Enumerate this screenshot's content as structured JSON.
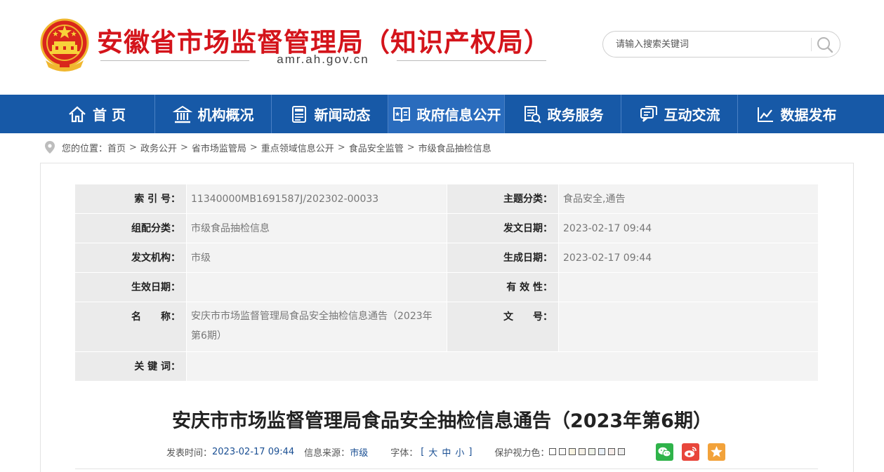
{
  "header": {
    "title": "安徽省市场监督管理局（知识产权局）",
    "domain": "amr.ah.gov.cn",
    "search_placeholder": "请输入搜索关键词"
  },
  "nav": [
    {
      "label": "首 页",
      "icon": "home-icon"
    },
    {
      "label": "机构概况",
      "icon": "building-icon"
    },
    {
      "label": "新闻动态",
      "icon": "news-icon"
    },
    {
      "label": "政府信息公开",
      "icon": "info-book-icon"
    },
    {
      "label": "政务服务",
      "icon": "service-doc-icon"
    },
    {
      "label": "互动交流",
      "icon": "chat-icon"
    },
    {
      "label": "数据发布",
      "icon": "chart-icon"
    }
  ],
  "breadcrumb": {
    "prefix": "您的位置：",
    "items": [
      "首页",
      "政务公开",
      "省市场监管局",
      "重点领域信息公开",
      "食品安全监管",
      "市级食品抽检信息"
    ],
    "separator": ">"
  },
  "meta": {
    "index_label": "索 引 号：",
    "index_value": "11340000MB1691587J/202302-00033",
    "topic_label": "主题分类：",
    "topic_value": "食品安全,通告",
    "group_label": "组配分类：",
    "group_value": "市级食品抽检信息",
    "issue_date_label": "发文日期：",
    "issue_date_value": "2023-02-17 09:44",
    "issuer_label": "发文机构：",
    "issuer_value": "市级",
    "created_label": "生成日期：",
    "created_value": "2023-02-17 09:44",
    "effective_label": "生效日期：",
    "effective_value": "",
    "validity_label": "有 效 性：",
    "validity_value": "",
    "name_label": "名　　称：",
    "name_value": "安庆市市场监督管理局食品安全抽检信息通告（2023年第6期）",
    "docno_label": "文　　号：",
    "docno_value": "",
    "keywords_label": "关 键 词：",
    "keywords_value": ""
  },
  "article": {
    "title": "安庆市市场监督管理局食品安全抽检信息通告（2023年第6期）",
    "publish_label": "发表时间：",
    "publish_value": "2023-02-17 09:44",
    "source_label": "信息来源：",
    "source_value": "市级",
    "font_label": "字体：",
    "font_open": "[",
    "font_large": "大",
    "font_medium": "中",
    "font_small": "小",
    "font_close": "]",
    "eye_label": "保护视力色："
  },
  "colors": {
    "brand_red": "#d4141b",
    "nav_blue": "#1759a7",
    "nav_active": "#2a6cbd",
    "link_blue": "#1a4f93",
    "eye_swatches": [
      "#ffffff",
      "#fafafa",
      "#f8f3e0",
      "#f5f0e6",
      "#eef2e8",
      "#e8f0f8",
      "#f6ece9",
      "#eeeeee"
    ],
    "wechat": "#2fb34a",
    "weibo": "#e8463b",
    "favorite": "#f2a23a"
  },
  "share": [
    "wechat-icon",
    "weibo-icon",
    "star-icon"
  ]
}
